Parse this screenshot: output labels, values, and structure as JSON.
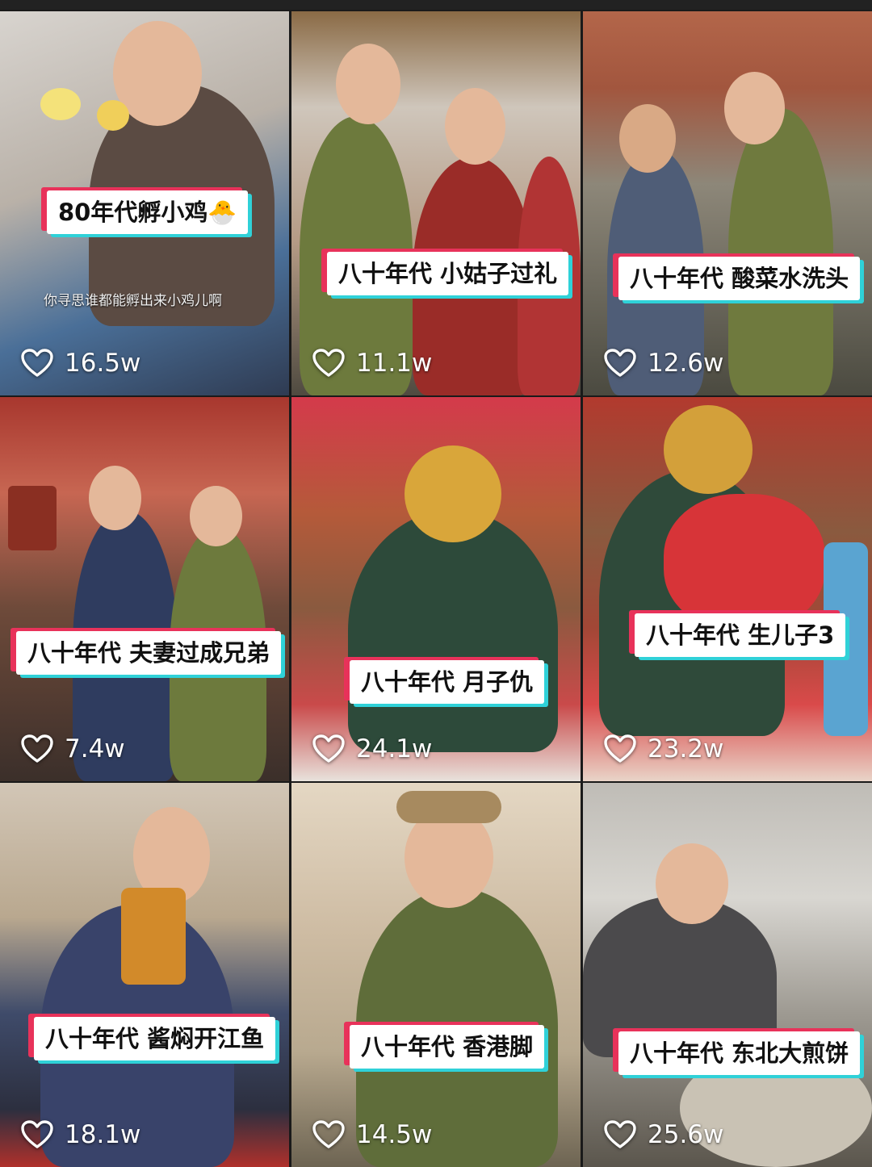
{
  "videos": [
    {
      "title": "80年代孵小鸡🐣",
      "likes": "16.5w",
      "subtitle": "你寻思谁都能孵出来小鸡儿啊"
    },
    {
      "title": "八十年代 小姑子过礼",
      "likes": "11.1w"
    },
    {
      "title": "八十年代 酸菜水洗头",
      "likes": "12.6w"
    },
    {
      "title": "八十年代 夫妻过成兄弟",
      "likes": "7.4w"
    },
    {
      "title": "八十年代 月子仇",
      "likes": "24.1w"
    },
    {
      "title": "八十年代 生儿子3",
      "likes": "23.2w"
    },
    {
      "title": "八十年代 酱焖开江鱼",
      "likes": "18.1w"
    },
    {
      "title": "八十年代 香港脚",
      "likes": "14.5w"
    },
    {
      "title": "八十年代 东北大煎饼",
      "likes": "25.6w"
    }
  ],
  "icons": {
    "like": "heart-outline-icon"
  },
  "colors": {
    "caption_bg": "#ffffff",
    "caption_accent_red": "#e8325a",
    "caption_accent_cyan": "#2fd1d8",
    "like_text": "#ffffff"
  }
}
